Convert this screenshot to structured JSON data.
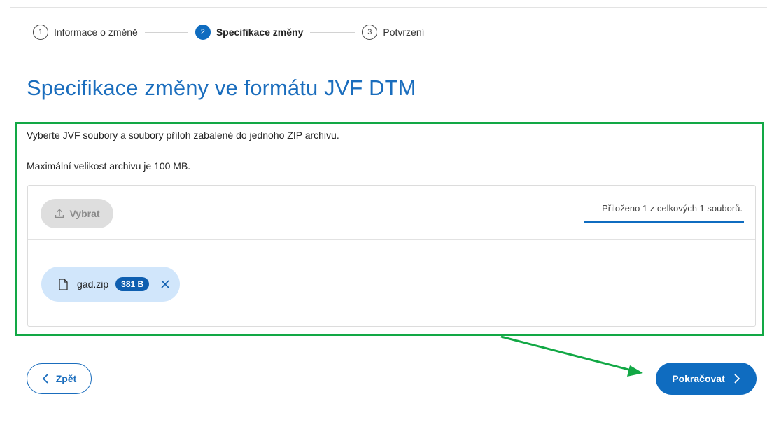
{
  "stepper": {
    "steps": [
      {
        "number": "1",
        "label": "Informace o změně",
        "active": false
      },
      {
        "number": "2",
        "label": "Specifikace změny",
        "active": true
      },
      {
        "number": "3",
        "label": "Potvrzení",
        "active": false
      }
    ]
  },
  "page": {
    "title": "Specifikace změny ve formátu JVF DTM",
    "description": "Vyberte JVF soubory a soubory příloh zabalené do jednoho ZIP archivu.",
    "size_limit": "Maximální velikost archivu je 100 MB."
  },
  "upload": {
    "select_label": "Vybrat",
    "select_icon": "upload-icon",
    "progress_text": "Přiloženo 1 z celkových 1 souborů.",
    "progress_fraction": 1.0,
    "files": [
      {
        "name": "gad.zip",
        "size": "381 B",
        "icon": "file-icon",
        "remove_icon": "close-icon"
      }
    ]
  },
  "actions": {
    "back_label": "Zpět",
    "next_label": "Pokračovat"
  },
  "colors": {
    "primary": "#0f6cc0",
    "annotation": "#12a845",
    "chip_bg": "#d1e6fb"
  }
}
